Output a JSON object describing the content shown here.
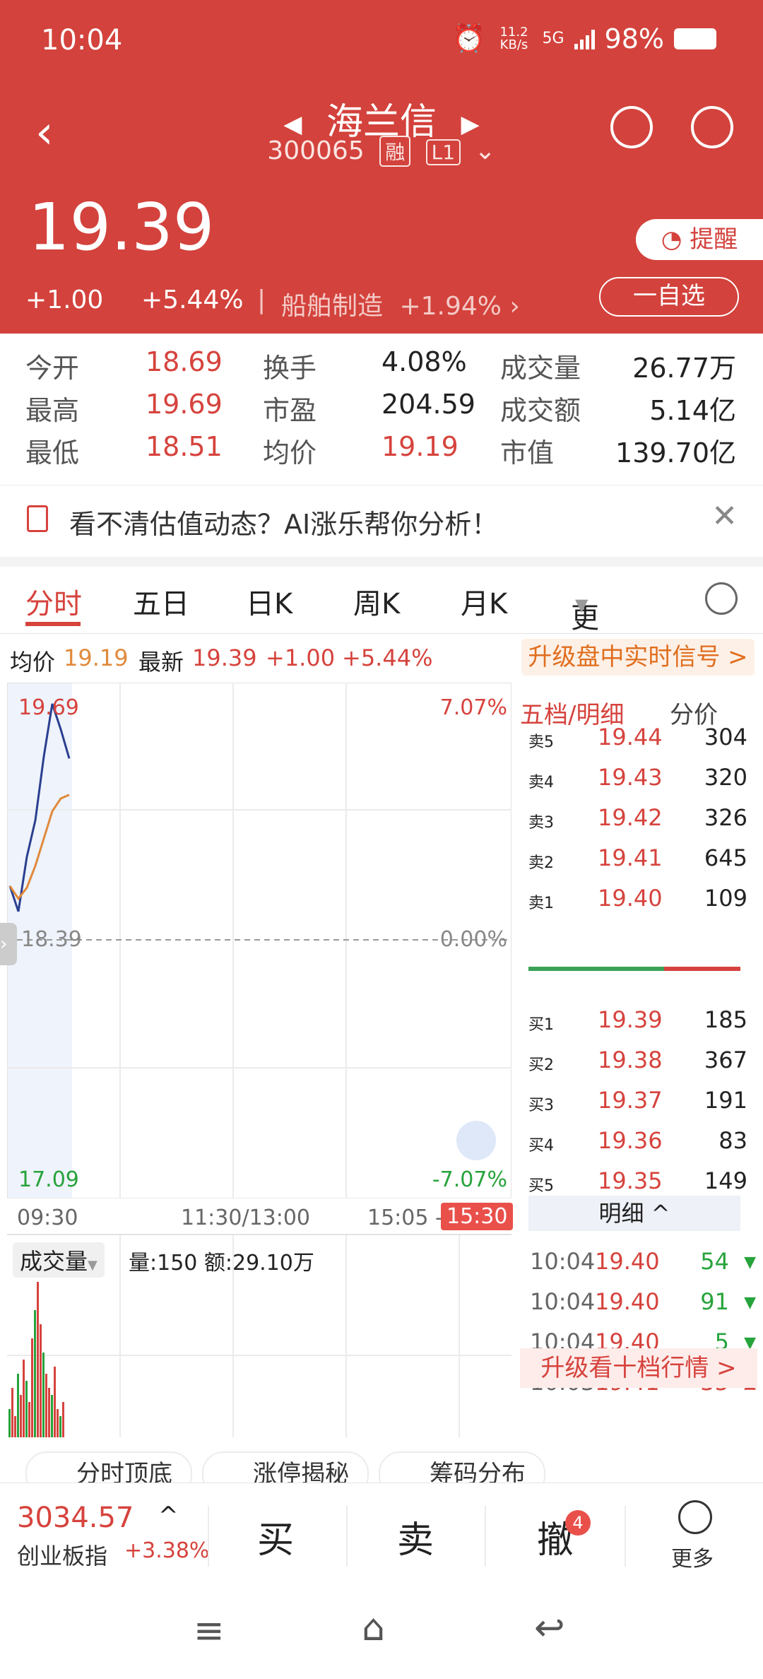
{
  "status_bar": {
    "time": "10:04",
    "net_speed": "11.2 KB/s",
    "network": "5G",
    "battery": "98%"
  },
  "stock": {
    "name": "海兰信",
    "code": "300065",
    "tags": [
      "融",
      "L1"
    ],
    "price": "19.39",
    "change": "+1.00",
    "change_pct": "+5.44%",
    "sector": "船舶制造",
    "sector_pct": "+1.94%",
    "alert_label": "提醒",
    "watch_label": "一自选"
  },
  "stats": [
    {
      "l1": "今开",
      "v1": "18.69",
      "l2": "换手",
      "v2": "4.08%",
      "l3": "成交量",
      "v3": "26.77万"
    },
    {
      "l1": "最高",
      "v1": "19.69",
      "l2": "市盈",
      "v2": "204.59",
      "l3": "成交额",
      "v3": "5.14亿"
    },
    {
      "l1": "最低",
      "v1": "18.51",
      "l2": "均价",
      "v2": "19.19",
      "l3": "市值",
      "v3": "139.70亿"
    }
  ],
  "ai_banner": {
    "text": "看不清估值动态？AI涨乐帮你分析！"
  },
  "tabs": [
    "分时",
    "五日",
    "日K",
    "周K",
    "月K",
    "更多"
  ],
  "chart_info": {
    "avg_label": "均价",
    "avg_value": "19.19",
    "latest_label": "最新",
    "latest_value": "19.39",
    "change": "+1.00",
    "change_pct": "+5.44%",
    "upgrade_label": "升级盘中实时信号 >"
  },
  "chart_axes": {
    "y_top": "19.69",
    "y_mid": "18.39",
    "y_bottom": "17.09",
    "pct_top": "7.07%",
    "pct_mid": "0.00%",
    "pct_bottom": "-7.07%",
    "x_labels": [
      "09:30",
      "11:30/13:00",
      "15:05 -",
      "15:30"
    ]
  },
  "volume": {
    "tab_label": "成交量",
    "info": "量:150 额:29.10万"
  },
  "chart_data": {
    "type": "line",
    "series": [
      {
        "name": "最新",
        "x": [
          "09:30",
          "09:35",
          "09:40",
          "09:45",
          "09:50",
          "09:55",
          "10:00",
          "10:04"
        ],
        "y": [
          18.69,
          18.55,
          18.85,
          19.05,
          19.4,
          19.69,
          19.55,
          19.39
        ]
      },
      {
        "name": "均价",
        "x": [
          "09:30",
          "09:35",
          "09:40",
          "09:45",
          "09:50",
          "09:55",
          "10:00",
          "10:04"
        ],
        "y": [
          18.69,
          18.62,
          18.68,
          18.8,
          18.95,
          19.1,
          19.17,
          19.19
        ]
      }
    ],
    "ylim": [
      17.09,
      19.69
    ],
    "reference": 18.39
  },
  "order_book": {
    "header": "五档/明细",
    "header2": "分价",
    "sells": [
      {
        "label": "卖5",
        "price": "19.44",
        "vol": "304"
      },
      {
        "label": "卖4",
        "price": "19.43",
        "vol": "320"
      },
      {
        "label": "卖3",
        "price": "19.42",
        "vol": "326"
      },
      {
        "label": "卖2",
        "price": "19.41",
        "vol": "645"
      },
      {
        "label": "卖1",
        "price": "19.40",
        "vol": "109"
      }
    ],
    "buys": [
      {
        "label": "买1",
        "price": "19.39",
        "vol": "185"
      },
      {
        "label": "买2",
        "price": "19.38",
        "vol": "367"
      },
      {
        "label": "买3",
        "price": "19.37",
        "vol": "191"
      },
      {
        "label": "买4",
        "price": "19.36",
        "vol": "83"
      },
      {
        "label": "买5",
        "price": "19.35",
        "vol": "149"
      }
    ],
    "detail_header": "明细 ^",
    "details": [
      {
        "time": "10:04",
        "price": "19.40",
        "vol": "54",
        "dir": "down"
      },
      {
        "time": "10:04",
        "price": "19.40",
        "vol": "91",
        "dir": "down"
      },
      {
        "time": "10:04",
        "price": "19.40",
        "vol": "5",
        "dir": "down"
      },
      {
        "time": "10:03",
        "price": "19.41",
        "vol": "35",
        "dir": "up"
      }
    ],
    "upgrade_label": "升级看十档行情 >"
  },
  "pills": [
    "分时顶底",
    "涨停揭秘",
    "筹码分布"
  ],
  "bottom": {
    "index_value": "3034.57",
    "index_name": "创业板指",
    "index_pct": "+3.38%",
    "buy": "买",
    "sell": "卖",
    "cancel": "撤",
    "cancel_badge": "4",
    "more": "更多"
  }
}
